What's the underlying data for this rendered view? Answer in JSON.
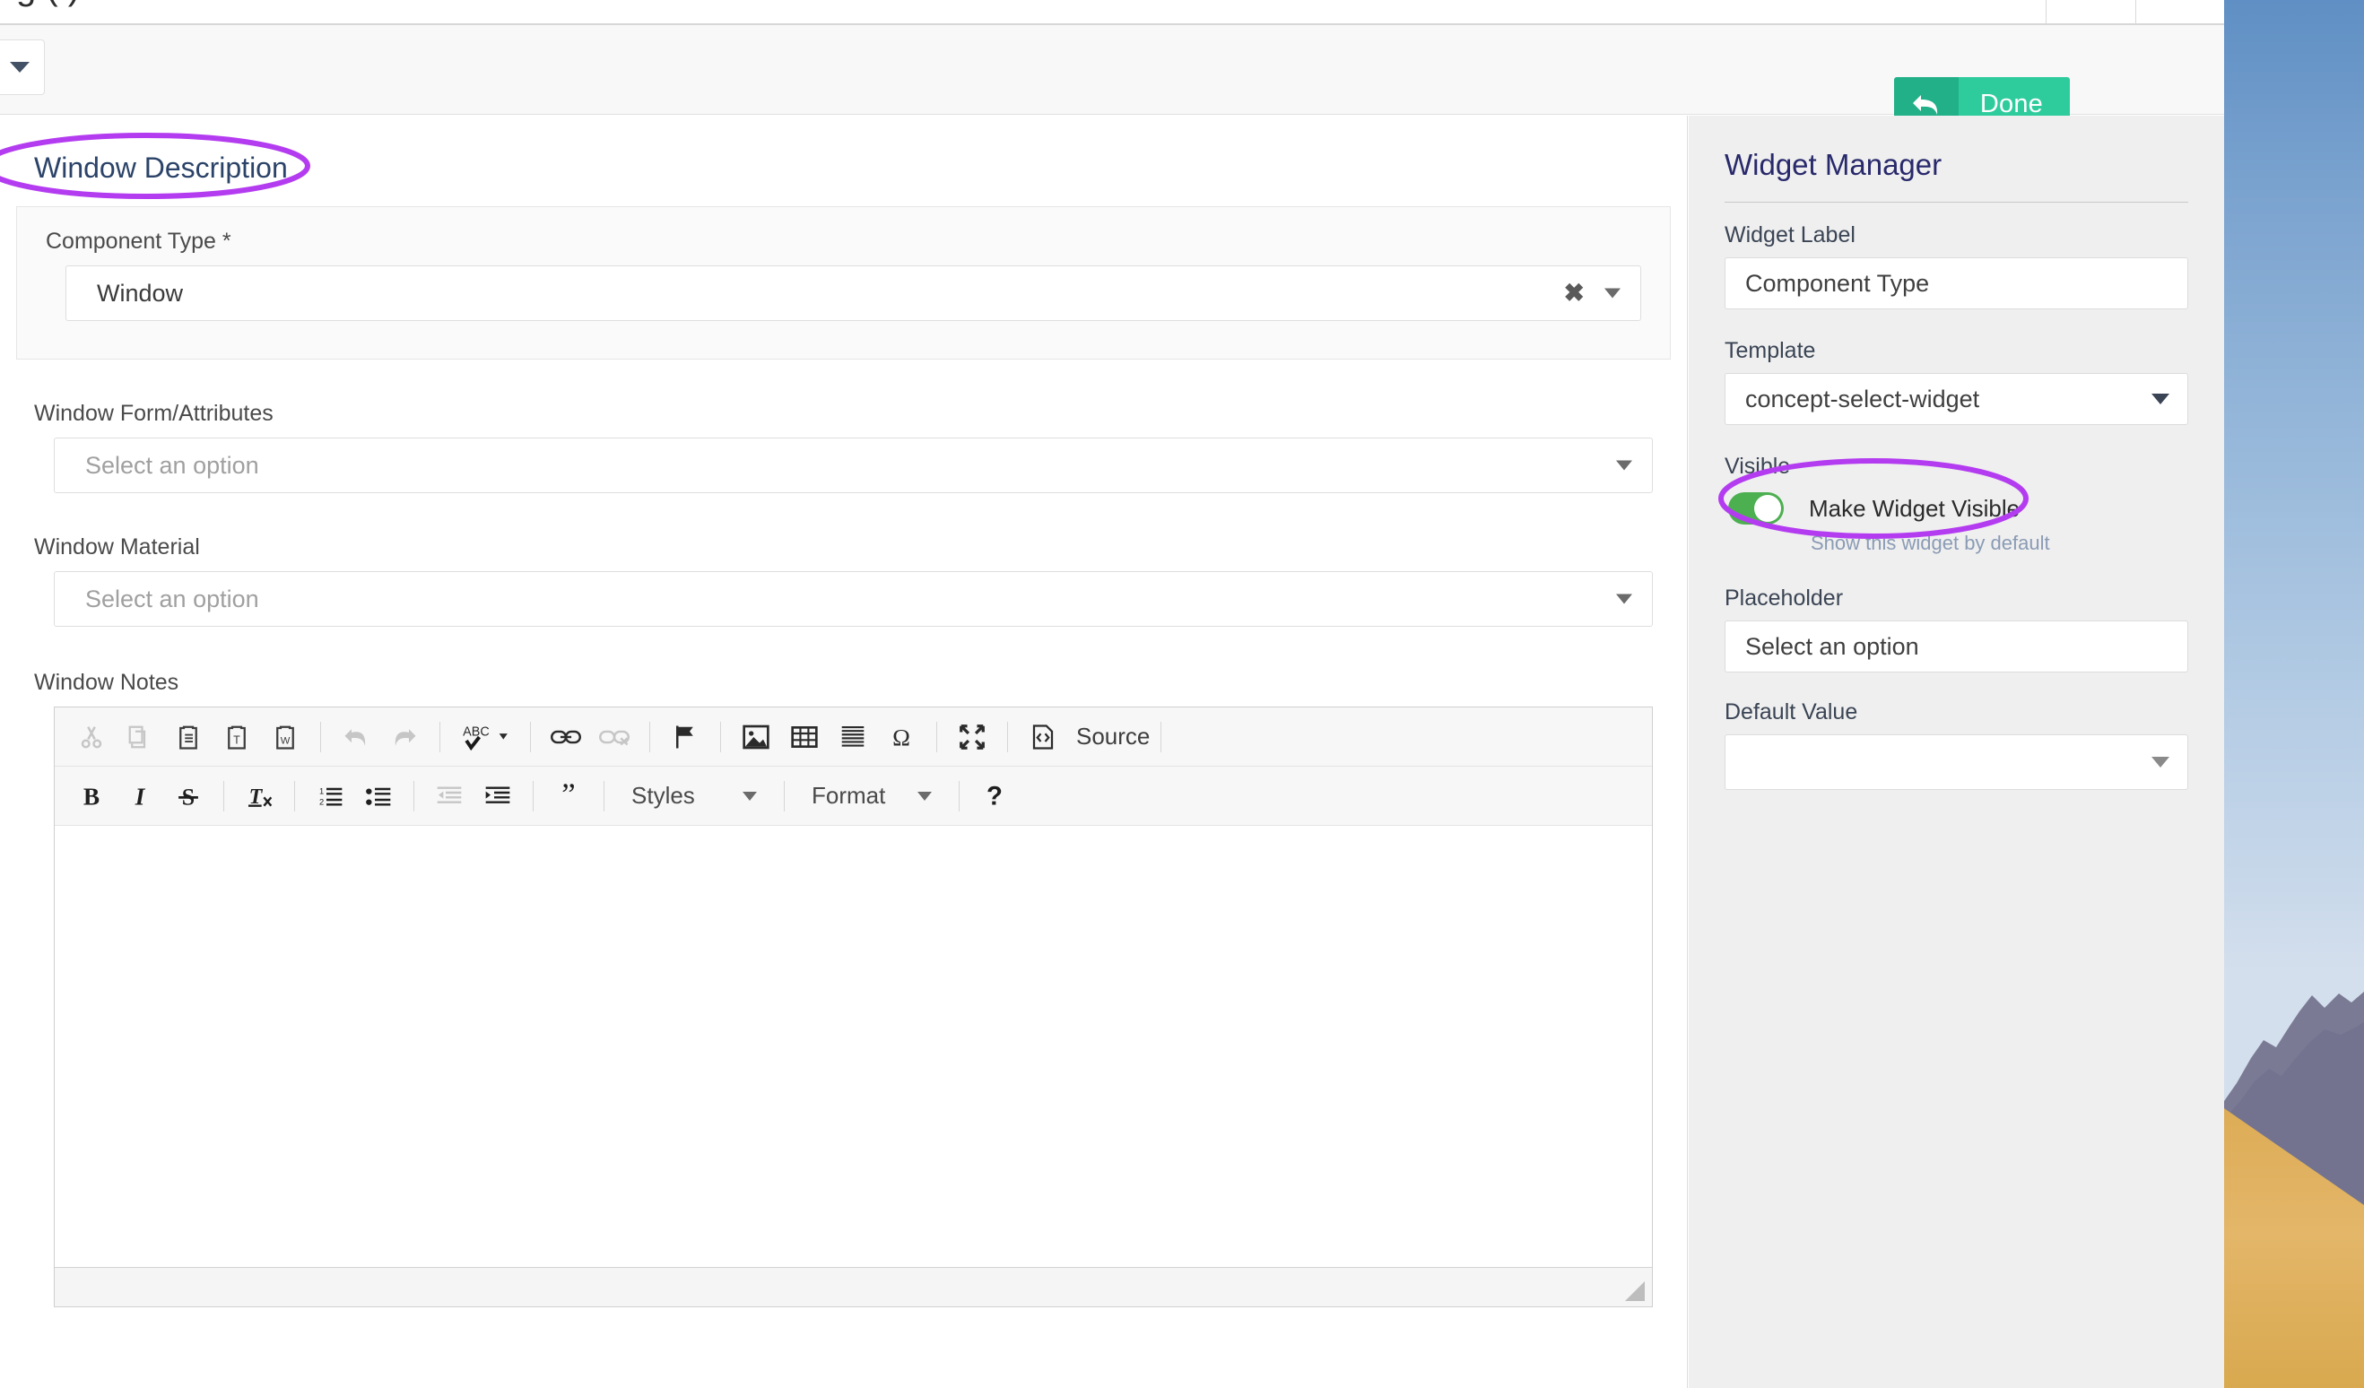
{
  "window": {
    "clipped_heading": "g (              )"
  },
  "action_bar": {
    "left_dropdown_icon": "chevron-down-icon",
    "done_label": "Done",
    "done_icon": "undo-arrow-icon",
    "done_color": "#2ecc9d"
  },
  "form": {
    "title": "Window Description",
    "component_type": {
      "label": "Component Type",
      "required_marker": "*",
      "value": "Window",
      "clear_icon": "✖",
      "caret_icon": "chevron-down-icon"
    },
    "fields": [
      {
        "label": "Window Form/Attributes",
        "placeholder": "Select an option",
        "value": ""
      },
      {
        "label": "Window Material",
        "placeholder": "Select an option",
        "value": ""
      }
    ],
    "notes": {
      "label": "Window Notes",
      "content": "",
      "toolbar_row1": [
        {
          "name": "cut-icon",
          "glyph": "✂",
          "disabled": true
        },
        {
          "name": "copy-icon",
          "glyph": "❐",
          "disabled": true
        },
        {
          "name": "paste-icon",
          "glyph": "ὌB",
          "disabled": false
        },
        {
          "name": "paste-as-plain-text-icon",
          "glyph": "T",
          "disabled": false
        },
        {
          "name": "paste-from-word-icon",
          "glyph": "W",
          "disabled": false
        },
        {
          "name": "undo-icon",
          "glyph": "↶",
          "disabled": true
        },
        {
          "name": "redo-icon",
          "glyph": "↷",
          "disabled": true
        },
        {
          "name": "spell-check-icon",
          "glyph": "ABC",
          "disabled": false
        },
        {
          "name": "link-icon",
          "glyph": "ὑ7",
          "disabled": false
        },
        {
          "name": "unlink-icon",
          "glyph": "ὑ7",
          "disabled": true
        },
        {
          "name": "anchor-flag-icon",
          "glyph": "⚑",
          "disabled": false
        },
        {
          "name": "image-icon",
          "glyph": "ὛC",
          "disabled": false
        },
        {
          "name": "table-icon",
          "glyph": "▦",
          "disabled": false
        },
        {
          "name": "horizontal-rule-icon",
          "glyph": "≡",
          "disabled": false
        },
        {
          "name": "special-character-icon",
          "glyph": "Ω",
          "disabled": false
        },
        {
          "name": "maximize-icon",
          "glyph": "⤡",
          "disabled": false
        },
        {
          "name": "source-icon",
          "glyph": "◇",
          "disabled": false
        }
      ],
      "source_label": "Source",
      "toolbar_row2": [
        {
          "name": "bold-icon",
          "glyph": "B",
          "disabled": false
        },
        {
          "name": "italic-icon",
          "glyph": "I",
          "disabled": false
        },
        {
          "name": "strikethrough-icon",
          "glyph": "S",
          "disabled": false
        },
        {
          "name": "remove-format-icon",
          "glyph": "Tx",
          "disabled": false
        },
        {
          "name": "numbered-list-icon",
          "glyph": "1≡",
          "disabled": false
        },
        {
          "name": "bulleted-list-icon",
          "glyph": "•≡",
          "disabled": false
        },
        {
          "name": "outdent-icon",
          "glyph": "⇤",
          "disabled": true
        },
        {
          "name": "indent-icon",
          "glyph": "⇥",
          "disabled": false
        },
        {
          "name": "blockquote-icon",
          "glyph": "”",
          "disabled": false
        }
      ],
      "styles_label": "Styles",
      "format_label": "Format",
      "help_label": "?"
    }
  },
  "widget_manager": {
    "title": "Widget Manager",
    "widget_label_caption": "Widget Label",
    "widget_label_value": "Component Type",
    "template_caption": "Template",
    "template_value": "concept-select-widget",
    "visible_caption": "Visible",
    "visible_toggle_label": "Make Widget Visible",
    "visible_toggle_help": "Show this widget by default",
    "visible_toggle_on": true,
    "placeholder_caption": "Placeholder",
    "placeholder_value": "Select an option",
    "default_value_caption": "Default Value",
    "default_value_value": ""
  },
  "annotations": {
    "color": "#b43cf0",
    "ellipse_1_target": "component-type-field",
    "ellipse_2_target": "default-value-field"
  },
  "wallpaper": {
    "sky_color": "#7ba3cf",
    "mountain_color": "#7b7a95",
    "sand_color": "#e0b05c"
  }
}
